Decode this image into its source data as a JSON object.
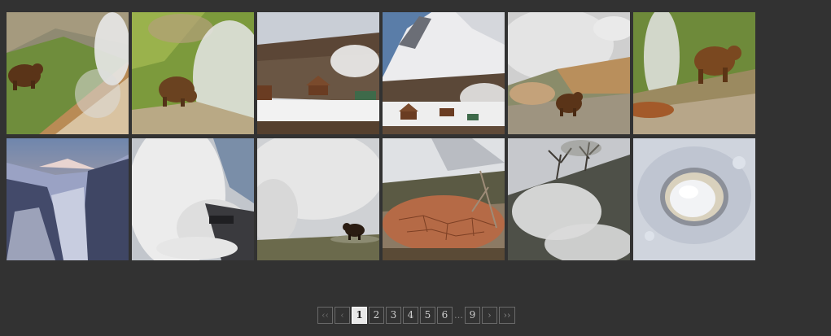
{
  "gallery": {
    "thumbnails": [
      {
        "icon": "bear-geyser-photo"
      },
      {
        "icon": "bear-grass-steam-photo"
      },
      {
        "icon": "snowy-valley-cabins-photo"
      },
      {
        "icon": "mountain-cabins-photo"
      },
      {
        "icon": "bear-steam-vents-photo"
      },
      {
        "icon": "bear-hillside-geyser-photo"
      },
      {
        "icon": "snowy-canyon-photo"
      },
      {
        "icon": "steam-cloud-photo"
      },
      {
        "icon": "bear-in-steam-photo"
      },
      {
        "icon": "cracked-mud-photo"
      },
      {
        "icon": "steaming-slope-trees-photo"
      },
      {
        "icon": "snow-hole-photo"
      }
    ]
  },
  "pagination": {
    "first": "‹‹",
    "prev": "‹",
    "pages": [
      "1",
      "2",
      "3",
      "4",
      "5",
      "6"
    ],
    "active_page": "1",
    "ellipsis": "…",
    "last_page": "9",
    "next": "›",
    "last": "››"
  },
  "colors": {
    "background": "#323232",
    "active_page_bg": "#e9e9e9",
    "border": "#6a6a6a"
  }
}
